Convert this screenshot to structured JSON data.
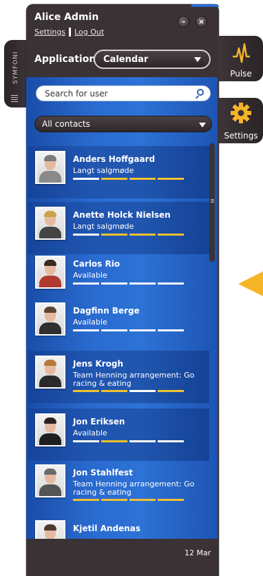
{
  "header": {
    "user_name": "Alice Admin",
    "settings_link": "Settings",
    "logout_link": "Log Out",
    "minimize_glyph": "–",
    "close_glyph": "×"
  },
  "side_tab": {
    "label": "SYMFONI"
  },
  "application": {
    "label": "Application",
    "selected": "Calendar"
  },
  "search": {
    "placeholder": "Search for user"
  },
  "filter": {
    "selected": "All contacts"
  },
  "contacts": [
    {
      "name": "Anders Hoffgaard",
      "status": "Langt salgmøde",
      "presence": [
        "white",
        "yellow",
        "yellow",
        "yellow"
      ],
      "hair": "#7a7a7a",
      "shirt": "#8a8a8a"
    },
    {
      "name": "Anette Holck Nielsen",
      "status": "Langt salgmøde",
      "presence": [
        "white",
        "yellow",
        "yellow",
        "yellow"
      ],
      "hair": "#c9a24a",
      "shirt": "#444444"
    },
    {
      "name": "Carlos Rio",
      "status": "Available",
      "presence": [
        "white",
        "white",
        "white",
        "white"
      ],
      "hair": "#3a2a20",
      "shirt": "#b03a2e"
    },
    {
      "name": "Dagfinn Berge",
      "status": "Available",
      "presence": [
        "white",
        "white",
        "white",
        "white"
      ],
      "hair": "#5a4535",
      "shirt": "#2f2f2f"
    },
    {
      "name": "Jens Krogh",
      "status": "Team Henning arrangement: Go racing & eating",
      "presence": [
        "yellow",
        "yellow",
        "white",
        "yellow"
      ],
      "hair": "#b77a3a",
      "shirt": "#2a2a2a"
    },
    {
      "name": "Jon Eriksen",
      "status": "Available",
      "presence": [
        "white",
        "yellow",
        "white",
        "white"
      ],
      "hair": "#2a2220",
      "shirt": "#1f1f1f"
    },
    {
      "name": "Jon Stahlfest",
      "status": "Team Henning arrangement: Go racing & eating",
      "presence": [
        "yellow",
        "yellow",
        "yellow",
        "yellow"
      ],
      "hair": "#6a6a6a",
      "shirt": "#555555"
    },
    {
      "name": "Kjetil Andenas",
      "status": "",
      "presence": [],
      "hair": "#4a3a30",
      "shirt": "#3a3a3a"
    }
  ],
  "footer": {
    "date": "12 Mar"
  },
  "tabs": {
    "pulse": "Pulse",
    "settings": "Settings"
  },
  "colors": {
    "presence_white": "#ffffff",
    "presence_yellow": "#f2c22e",
    "accent_orange": "#f5b527",
    "frame": "#3a3235"
  }
}
